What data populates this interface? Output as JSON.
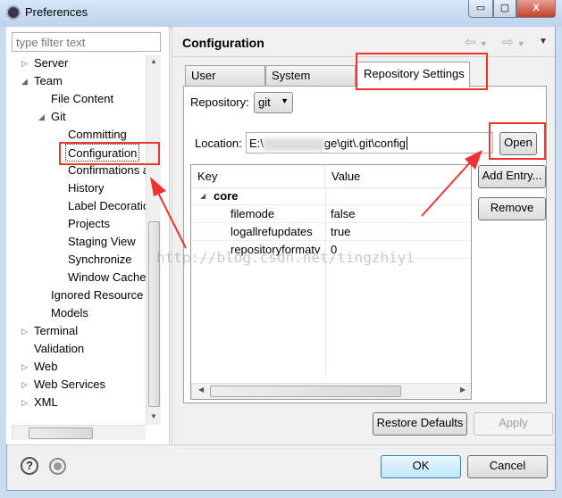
{
  "window": {
    "title": "Preferences",
    "minimize": "▭",
    "maximize": "▢",
    "close": "X"
  },
  "sidebar": {
    "filter_placeholder": "type filter text",
    "items": [
      {
        "label": "Server",
        "twisty": "▷"
      },
      {
        "label": "Team",
        "twisty": "◢"
      },
      {
        "label": "File Content"
      },
      {
        "label": "Git",
        "twisty": "◢"
      },
      {
        "label": "Committing"
      },
      {
        "label": "Configuration"
      },
      {
        "label": "Confirmations a"
      },
      {
        "label": "History"
      },
      {
        "label": "Label Decoratio"
      },
      {
        "label": "Projects"
      },
      {
        "label": "Staging View"
      },
      {
        "label": "Synchronize"
      },
      {
        "label": "Window Cache"
      },
      {
        "label": "Ignored Resource"
      },
      {
        "label": "Models"
      },
      {
        "label": "Terminal",
        "twisty": "▷"
      },
      {
        "label": "Validation"
      },
      {
        "label": "Web",
        "twisty": "▷"
      },
      {
        "label": "Web Services",
        "twisty": "▷"
      },
      {
        "label": "XML",
        "twisty": "▷"
      }
    ],
    "selected": "Configuration"
  },
  "main": {
    "title": "Configuration",
    "tabs": [
      {
        "label": "User Settings"
      },
      {
        "label": "System Settings"
      },
      {
        "label": "Repository Settings",
        "active": true
      }
    ],
    "repository_label": "Repository:",
    "repository_value": "git",
    "location_label": "Location:",
    "location_value_start": "E:\\",
    "location_value_end": "ge\\git\\.git\\config",
    "open_button": "Open",
    "add_entry_button": "Add Entry...",
    "remove_button": "Remove",
    "table": {
      "columns": [
        "Key",
        "Value"
      ],
      "group": "core",
      "rows": [
        {
          "key": "filemode",
          "value": "false"
        },
        {
          "key": "logallrefupdates",
          "value": "true"
        },
        {
          "key": "repositoryformatv",
          "value": "0"
        }
      ]
    },
    "restore_defaults": "Restore Defaults",
    "apply": "Apply"
  },
  "footer": {
    "ok": "OK",
    "cancel": "Cancel",
    "help_icon": "?"
  },
  "watermark": "http://blog.csdn.net/tingzhiyi",
  "annotation_color": "#ee3333"
}
